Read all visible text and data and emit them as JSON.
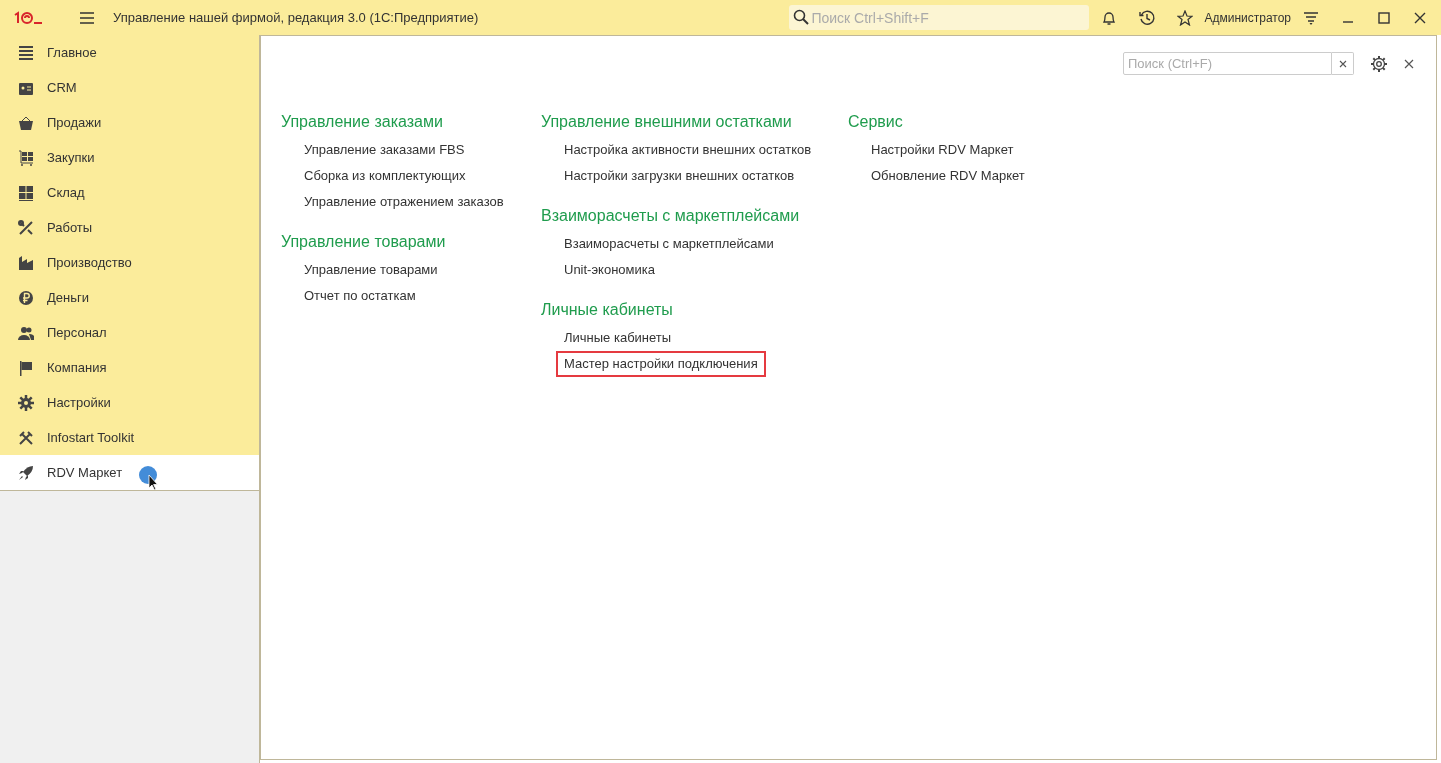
{
  "titlebar": {
    "title": "Управление нашей фирмой, редакция 3.0  (1С:Предприятие)",
    "search": {
      "placeholder": "Поиск Ctrl+Shift+F"
    },
    "user": "Администратор"
  },
  "sidebar": {
    "items": [
      {
        "label": "Главное",
        "kind": "main",
        "selected": false
      },
      {
        "label": "CRM",
        "kind": "crm",
        "selected": false
      },
      {
        "label": "Продажи",
        "kind": "sales",
        "selected": false
      },
      {
        "label": "Закупки",
        "kind": "purchases",
        "selected": false
      },
      {
        "label": "Склад",
        "kind": "warehouse",
        "selected": false
      },
      {
        "label": "Работы",
        "kind": "works",
        "selected": false
      },
      {
        "label": "Производство",
        "kind": "production",
        "selected": false
      },
      {
        "label": "Деньги",
        "kind": "money",
        "selected": false
      },
      {
        "label": "Персонал",
        "kind": "staff",
        "selected": false
      },
      {
        "label": "Компания",
        "kind": "company",
        "selected": false
      },
      {
        "label": "Настройки",
        "kind": "settings",
        "selected": false
      },
      {
        "label": "Infostart Toolkit",
        "kind": "toolkit",
        "selected": false
      },
      {
        "label": "RDV Маркет",
        "kind": "rocket",
        "selected": true
      }
    ]
  },
  "panel": {
    "search": {
      "placeholder": "Поиск (Ctrl+F)"
    },
    "columns": [
      {
        "groups": [
          {
            "heading": "Управление заказами",
            "links": [
              {
                "label": "Управление заказами FBS",
                "highlighted": false
              },
              {
                "label": "Сборка из комплектующих",
                "highlighted": false
              },
              {
                "label": "Управление отражением заказов",
                "highlighted": false
              }
            ]
          },
          {
            "heading": "Управление товарами",
            "links": [
              {
                "label": "Управление товарами",
                "highlighted": false
              },
              {
                "label": "Отчет по остаткам",
                "highlighted": false
              }
            ]
          }
        ]
      },
      {
        "groups": [
          {
            "heading": "Управление внешними остатками",
            "links": [
              {
                "label": "Настройка активности внешних остатков",
                "highlighted": false
              },
              {
                "label": "Настройки загрузки внешних остатков",
                "highlighted": false
              }
            ]
          },
          {
            "heading": "Взаиморасчеты с маркетплейсами",
            "links": [
              {
                "label": "Взаиморасчеты с маркетплейсами",
                "highlighted": false
              },
              {
                "label": "Unit-экономика",
                "highlighted": false
              }
            ]
          },
          {
            "heading": "Личные кабинеты",
            "links": [
              {
                "label": "Личные кабинеты",
                "highlighted": false
              },
              {
                "label": "Мастер настройки подключения",
                "highlighted": true
              }
            ]
          }
        ]
      },
      {
        "groups": [
          {
            "heading": "Сервис",
            "links": [
              {
                "label": "Настройки RDV Маркет",
                "highlighted": false
              },
              {
                "label": "Обновление RDV Маркет",
                "highlighted": false
              }
            ]
          }
        ]
      }
    ]
  }
}
